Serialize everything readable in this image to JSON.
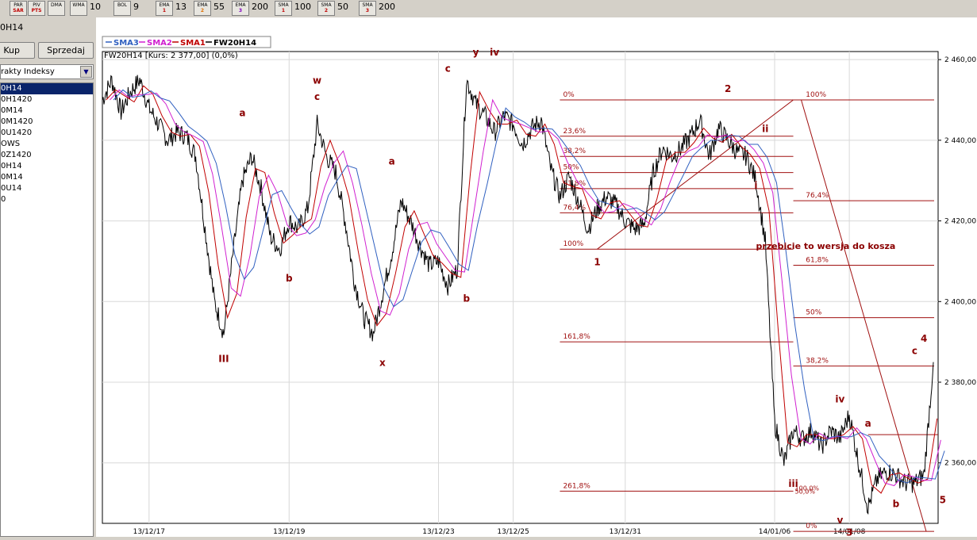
{
  "toolbar": {
    "buttons": [
      {
        "top": "PAR",
        "bottom": "SAR",
        "sub_class": ""
      },
      {
        "top": "PIV",
        "bottom": "PTS",
        "sub_class": ""
      },
      {
        "top": "DMA",
        "bottom": "",
        "sub_class": ""
      },
      {
        "top": "WMA",
        "bottom": "",
        "value": "10",
        "sub_class": ""
      },
      {
        "top": "BOL",
        "bottom": "",
        "value": "9",
        "sub_class": ""
      },
      {
        "top": "EMA",
        "bottom": "1",
        "value": "13",
        "sub_class": ""
      },
      {
        "top": "EMA",
        "bottom": "2",
        "value": "55",
        "sub_class": "o"
      },
      {
        "top": "EMA",
        "bottom": "3",
        "value": "200",
        "sub_class": "p"
      },
      {
        "top": "SMA",
        "bottom": "1",
        "value": "100",
        "sub_class": ""
      },
      {
        "top": "SMA",
        "bottom": "2",
        "value": "50",
        "sub_class": ""
      },
      {
        "top": "SMA",
        "bottom": "3",
        "value": "200",
        "sub_class": ""
      }
    ]
  },
  "left_panel": {
    "title": "0H14",
    "buy_label": "Kup",
    "sell_label": "Sprzedaj",
    "select_value": "rakty Indeksy",
    "items": [
      "0H14",
      "0H1420",
      "0M14",
      "0M1420",
      "0U1420",
      "OWS",
      "0Z1420",
      "0H14",
      "0M14",
      "0U14",
      "0"
    ],
    "selected_index": 0
  },
  "chart": {
    "legend": [
      {
        "name": "SMA3",
        "color": "#3060c0"
      },
      {
        "name": "SMA2",
        "color": "#d020d0"
      },
      {
        "name": "SMA1",
        "color": "#c00000"
      },
      {
        "name": "FW20H14",
        "color": "#000000"
      }
    ],
    "info": "FW20H14 [Kurs: 2 377,00] (0,0%)",
    "annotation_color": "#8b0000",
    "colors": {
      "price": "#000000",
      "sma1": "#c00000",
      "sma2": "#d020d0",
      "sma3": "#3060c0",
      "fib": "#a01010"
    }
  },
  "chart_data": {
    "type": "line",
    "title": "FW20H14 [Kurs: 2 377,00] (0,0%)",
    "xlabel": "",
    "ylabel": "",
    "x_ticks": [
      "13/12/17",
      "13/12/19",
      "13/12/23",
      "13/12/25",
      "13/12/31",
      "14/01/06",
      "14/01/08"
    ],
    "y_ticks": [
      2360,
      2380,
      2400,
      2420,
      2440,
      2460
    ],
    "y_tick_labels": [
      "2 360,00",
      "2 380,00",
      "2 400,00",
      "2 420,00",
      "2 440,00",
      "2 460,00"
    ],
    "ylim": [
      2345,
      2462
    ],
    "grid": true,
    "series": [
      {
        "name": "FW20H14",
        "values": [
          2450,
          2455,
          2447,
          2452,
          2455,
          2448,
          2444,
          2440,
          2442,
          2441,
          2436,
          2418,
          2400,
          2392,
          2412,
          2430,
          2436,
          2428,
          2416,
          2413,
          2420,
          2418,
          2423,
          2444,
          2436,
          2432,
          2420,
          2405,
          2396,
          2392,
          2402,
          2412,
          2425,
          2420,
          2414,
          2409,
          2410,
          2404,
          2408,
          2455,
          2449,
          2446,
          2442,
          2446,
          2444,
          2439,
          2443,
          2445,
          2433,
          2426,
          2431,
          2425,
          2418,
          2423,
          2426,
          2424,
          2420,
          2418,
          2419,
          2432,
          2438,
          2436,
          2438,
          2441,
          2445,
          2436,
          2443,
          2440,
          2437,
          2436,
          2430,
          2415,
          2370,
          2360,
          2368,
          2366,
          2368,
          2364,
          2368,
          2366,
          2372,
          2360,
          2349,
          2356,
          2358,
          2357,
          2355,
          2355,
          2357,
          2385
        ]
      },
      {
        "name": "SMA1"
      },
      {
        "name": "SMA2"
      },
      {
        "name": "SMA3"
      }
    ],
    "fib_levels": [
      {
        "label": "0%",
        "value": 2450
      },
      {
        "label": "23,6%",
        "value": 2441
      },
      {
        "label": "38,2%",
        "value": 2436
      },
      {
        "label": "50%",
        "value": 2432
      },
      {
        "label": "61,8%",
        "value": 2428
      },
      {
        "label": "76,4%",
        "value": 2422
      },
      {
        "label": "100%",
        "value": 2413
      },
      {
        "label": "161,8%",
        "value": 2390
      },
      {
        "label": "261,8%",
        "value": 2353
      }
    ],
    "fib_levels_2": [
      {
        "label": "100%",
        "value": 2450
      },
      {
        "label": "76,4%",
        "value": 2425
      },
      {
        "label": "61,8%",
        "value": 2409
      },
      {
        "label": "50%",
        "value": 2396
      },
      {
        "label": "38,2%",
        "value": 2384
      },
      {
        "label": "0%",
        "value": 2343
      }
    ],
    "annotations": [
      {
        "text": "a",
        "i": 15,
        "v": 2446
      },
      {
        "text": "b",
        "i": 20,
        "v": 2405
      },
      {
        "text": "III",
        "i": 13,
        "v": 2385
      },
      {
        "text": "w",
        "i": 23,
        "v": 2454
      },
      {
        "text": "c",
        "i": 23,
        "v": 2450
      },
      {
        "text": "a",
        "i": 31,
        "v": 2434
      },
      {
        "text": "x",
        "i": 30,
        "v": 2384
      },
      {
        "text": "c",
        "i": 37,
        "v": 2457
      },
      {
        "text": "y",
        "i": 40,
        "v": 2461
      },
      {
        "text": "iv",
        "i": 42,
        "v": 2461
      },
      {
        "text": "b",
        "i": 39,
        "v": 2400
      },
      {
        "text": "1",
        "i": 53,
        "v": 2409
      },
      {
        "text": "2",
        "i": 67,
        "v": 2452
      },
      {
        "text": "ii",
        "i": 71,
        "v": 2442
      },
      {
        "text": "i",
        "i": 70,
        "v": 2428
      },
      {
        "text": "przebicie  to wersja do kosza",
        "i": 70,
        "v": 2413
      },
      {
        "text": "iii",
        "i": 74,
        "v": 2354
      },
      {
        "text": "iv",
        "i": 79,
        "v": 2375
      },
      {
        "text": "a",
        "i": 82,
        "v": 2369
      },
      {
        "text": "v",
        "i": 79,
        "v": 2345
      },
      {
        "text": "3",
        "i": 80,
        "v": 2342
      },
      {
        "text": "b",
        "i": 85,
        "v": 2349
      },
      {
        "text": "c",
        "i": 87,
        "v": 2387
      },
      {
        "text": "4",
        "i": 88,
        "v": 2390
      },
      {
        "text": "5",
        "i": 90,
        "v": 2350
      }
    ],
    "fib_marks": [
      "100,0%",
      "50,0%"
    ]
  }
}
